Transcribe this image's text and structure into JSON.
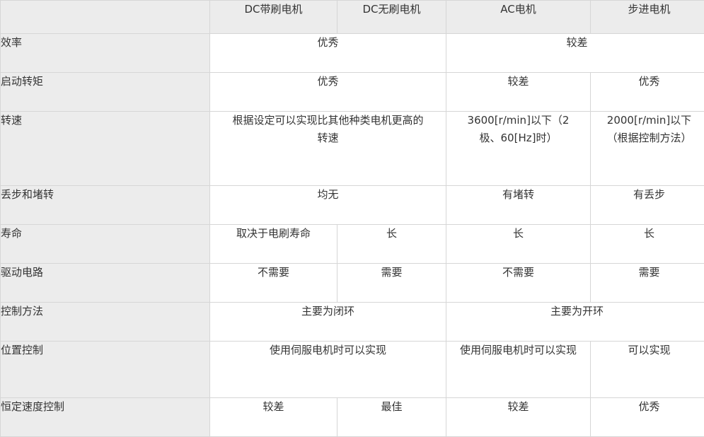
{
  "table": {
    "headers": [
      "",
      "DC带刷电机",
      "DC无刷电机",
      "AC电机",
      "步进电机"
    ],
    "rows": [
      {
        "label": "效率",
        "dc_group": "优秀",
        "acstep_group": "较差"
      },
      {
        "label": "启动转矩",
        "dc_group": "优秀",
        "ac": "较差",
        "stepper": "优秀"
      },
      {
        "label": "转速",
        "dc_group": "根据设定可以实现比其他种类电机更高的转速",
        "ac": "3600[r/min]以下（2极、60[Hz]时）",
        "stepper": "2000[r/min]以下（根据控制方法）"
      },
      {
        "label": "丢步和堵转",
        "dc_group": "均无",
        "ac": "有堵转",
        "stepper": "有丢步"
      },
      {
        "label": "寿命",
        "dc_brushed": "取决于电刷寿命",
        "dc_brushless": "长",
        "ac": "长",
        "stepper": "长"
      },
      {
        "label": "驱动电路",
        "dc_brushed": "不需要",
        "dc_brushless": "需要",
        "ac": "不需要",
        "stepper": "需要"
      },
      {
        "label": "控制方法",
        "dc_group": "主要为闭环",
        "acstep_group": "主要为开环"
      },
      {
        "label": "位置控制",
        "dc_group": "使用伺服电机时可以实现",
        "ac": "使用伺服电机时可以实现",
        "stepper": "可以实现"
      },
      {
        "label": "恒定速度控制",
        "dc_brushed": "较差",
        "dc_brushless": "最佳",
        "ac": "较差",
        "stepper": "优秀"
      }
    ]
  }
}
